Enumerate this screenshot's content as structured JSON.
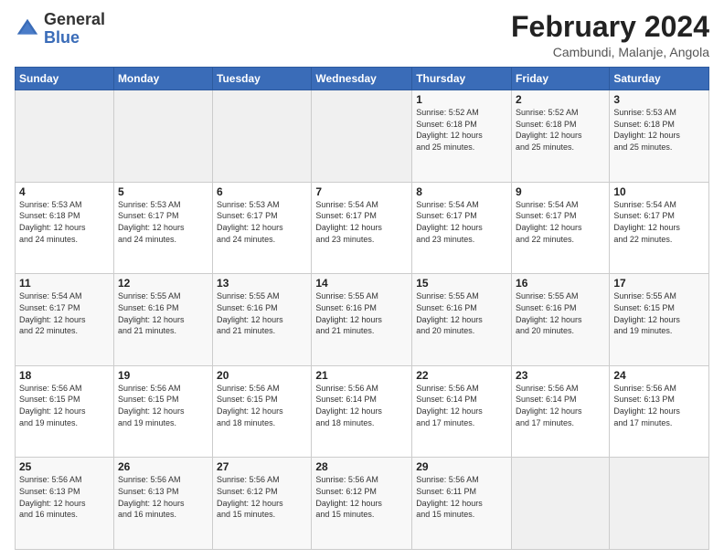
{
  "logo": {
    "general": "General",
    "blue": "Blue"
  },
  "header": {
    "month": "February 2024",
    "location": "Cambundi, Malanje, Angola"
  },
  "weekdays": [
    "Sunday",
    "Monday",
    "Tuesday",
    "Wednesday",
    "Thursday",
    "Friday",
    "Saturday"
  ],
  "weeks": [
    [
      {
        "day": "",
        "info": ""
      },
      {
        "day": "",
        "info": ""
      },
      {
        "day": "",
        "info": ""
      },
      {
        "day": "",
        "info": ""
      },
      {
        "day": "1",
        "info": "Sunrise: 5:52 AM\nSunset: 6:18 PM\nDaylight: 12 hours\nand 25 minutes."
      },
      {
        "day": "2",
        "info": "Sunrise: 5:52 AM\nSunset: 6:18 PM\nDaylight: 12 hours\nand 25 minutes."
      },
      {
        "day": "3",
        "info": "Sunrise: 5:53 AM\nSunset: 6:18 PM\nDaylight: 12 hours\nand 25 minutes."
      }
    ],
    [
      {
        "day": "4",
        "info": "Sunrise: 5:53 AM\nSunset: 6:18 PM\nDaylight: 12 hours\nand 24 minutes."
      },
      {
        "day": "5",
        "info": "Sunrise: 5:53 AM\nSunset: 6:17 PM\nDaylight: 12 hours\nand 24 minutes."
      },
      {
        "day": "6",
        "info": "Sunrise: 5:53 AM\nSunset: 6:17 PM\nDaylight: 12 hours\nand 24 minutes."
      },
      {
        "day": "7",
        "info": "Sunrise: 5:54 AM\nSunset: 6:17 PM\nDaylight: 12 hours\nand 23 minutes."
      },
      {
        "day": "8",
        "info": "Sunrise: 5:54 AM\nSunset: 6:17 PM\nDaylight: 12 hours\nand 23 minutes."
      },
      {
        "day": "9",
        "info": "Sunrise: 5:54 AM\nSunset: 6:17 PM\nDaylight: 12 hours\nand 22 minutes."
      },
      {
        "day": "10",
        "info": "Sunrise: 5:54 AM\nSunset: 6:17 PM\nDaylight: 12 hours\nand 22 minutes."
      }
    ],
    [
      {
        "day": "11",
        "info": "Sunrise: 5:54 AM\nSunset: 6:17 PM\nDaylight: 12 hours\nand 22 minutes."
      },
      {
        "day": "12",
        "info": "Sunrise: 5:55 AM\nSunset: 6:16 PM\nDaylight: 12 hours\nand 21 minutes."
      },
      {
        "day": "13",
        "info": "Sunrise: 5:55 AM\nSunset: 6:16 PM\nDaylight: 12 hours\nand 21 minutes."
      },
      {
        "day": "14",
        "info": "Sunrise: 5:55 AM\nSunset: 6:16 PM\nDaylight: 12 hours\nand 21 minutes."
      },
      {
        "day": "15",
        "info": "Sunrise: 5:55 AM\nSunset: 6:16 PM\nDaylight: 12 hours\nand 20 minutes."
      },
      {
        "day": "16",
        "info": "Sunrise: 5:55 AM\nSunset: 6:16 PM\nDaylight: 12 hours\nand 20 minutes."
      },
      {
        "day": "17",
        "info": "Sunrise: 5:55 AM\nSunset: 6:15 PM\nDaylight: 12 hours\nand 19 minutes."
      }
    ],
    [
      {
        "day": "18",
        "info": "Sunrise: 5:56 AM\nSunset: 6:15 PM\nDaylight: 12 hours\nand 19 minutes."
      },
      {
        "day": "19",
        "info": "Sunrise: 5:56 AM\nSunset: 6:15 PM\nDaylight: 12 hours\nand 19 minutes."
      },
      {
        "day": "20",
        "info": "Sunrise: 5:56 AM\nSunset: 6:15 PM\nDaylight: 12 hours\nand 18 minutes."
      },
      {
        "day": "21",
        "info": "Sunrise: 5:56 AM\nSunset: 6:14 PM\nDaylight: 12 hours\nand 18 minutes."
      },
      {
        "day": "22",
        "info": "Sunrise: 5:56 AM\nSunset: 6:14 PM\nDaylight: 12 hours\nand 17 minutes."
      },
      {
        "day": "23",
        "info": "Sunrise: 5:56 AM\nSunset: 6:14 PM\nDaylight: 12 hours\nand 17 minutes."
      },
      {
        "day": "24",
        "info": "Sunrise: 5:56 AM\nSunset: 6:13 PM\nDaylight: 12 hours\nand 17 minutes."
      }
    ],
    [
      {
        "day": "25",
        "info": "Sunrise: 5:56 AM\nSunset: 6:13 PM\nDaylight: 12 hours\nand 16 minutes."
      },
      {
        "day": "26",
        "info": "Sunrise: 5:56 AM\nSunset: 6:13 PM\nDaylight: 12 hours\nand 16 minutes."
      },
      {
        "day": "27",
        "info": "Sunrise: 5:56 AM\nSunset: 6:12 PM\nDaylight: 12 hours\nand 15 minutes."
      },
      {
        "day": "28",
        "info": "Sunrise: 5:56 AM\nSunset: 6:12 PM\nDaylight: 12 hours\nand 15 minutes."
      },
      {
        "day": "29",
        "info": "Sunrise: 5:56 AM\nSunset: 6:11 PM\nDaylight: 12 hours\nand 15 minutes."
      },
      {
        "day": "",
        "info": ""
      },
      {
        "day": "",
        "info": ""
      }
    ]
  ]
}
